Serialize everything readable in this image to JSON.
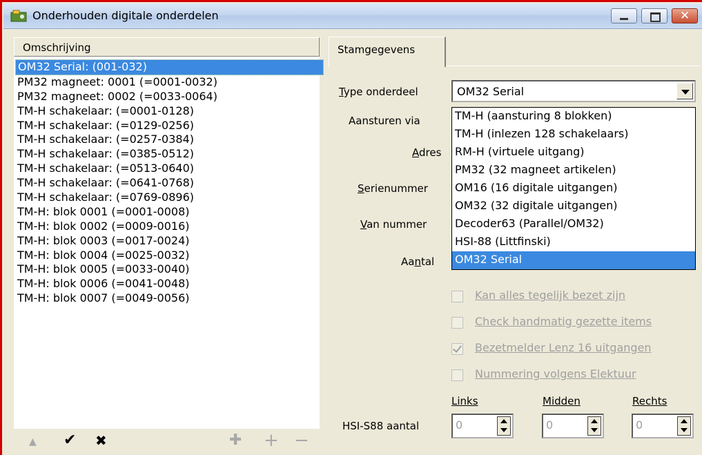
{
  "window": {
    "title": "Onderhouden digitale onderdelen",
    "icon": "app-icon",
    "controls": [
      "minimize-icon",
      "maximize-icon",
      "close-icon"
    ]
  },
  "left": {
    "column_header": "Omschrijving",
    "items": [
      "OM32 Serial: (001-032)",
      "PM32 magneet: 0001 (=0001-0032)",
      "PM32 magneet: 0002 (=0033-0064)",
      "TM-H schakelaar:  (=0001-0128)",
      "TM-H schakelaar:  (=0129-0256)",
      "TM-H schakelaar:  (=0257-0384)",
      "TM-H schakelaar:  (=0385-0512)",
      "TM-H schakelaar:  (=0513-0640)",
      "TM-H schakelaar:  (=0641-0768)",
      "TM-H schakelaar:  (=0769-0896)",
      "TM-H: blok 0001 (=0001-0008)",
      "TM-H: blok 0002 (=0009-0016)",
      "TM-H: blok 0003 (=0017-0024)",
      "TM-H: blok 0004 (=0025-0032)",
      "TM-H: blok 0005 (=0033-0040)",
      "TM-H: blok 0006 (=0041-0048)",
      "TM-H: blok 0007 (=0049-0056)"
    ],
    "toolbar": {
      "up": "▲",
      "ok": "✔",
      "cancel": "✖",
      "add_multi": "✚",
      "add": "+",
      "remove": "−"
    }
  },
  "tab": {
    "label": "Stamgegevens"
  },
  "form": {
    "type_label_u": "T",
    "type_label_rest": "ype onderdeel",
    "aansturen_label": "Aansturen via",
    "adres_label_u": "A",
    "adres_label_rest": "dres",
    "serie_label_u": "S",
    "serie_label_rest": "erienummer",
    "van_label_u": "V",
    "van_label_rest": "an nummer",
    "aantal_label_pre": "Aa",
    "aantal_label_u": "n",
    "aantal_label_rest": "tal",
    "type_value": "OM32 Serial",
    "options": [
      "TM-H (aansturing 8 blokken)",
      "TM-H (inlezen 128 schakelaars)",
      "RM-H (virtuele uitgang)",
      "PM32 (32 magneet artikelen)",
      "OM16 (16 digitale uitgangen)",
      "OM32 (32 digitale uitgangen)",
      "Decoder63 (Parallel/OM32)",
      "HSI-88 (Littfinski)",
      "OM32 Serial"
    ],
    "checkboxes": [
      {
        "label": "Kan alles tegelijk bezet zijn",
        "checked": false
      },
      {
        "label": "Check handmatig gezette items",
        "checked": false
      },
      {
        "label": "Bezetmelder Lenz 16 uitgangen",
        "checked": true
      },
      {
        "label": "Nummering volgens Elektuur",
        "checked": false
      }
    ],
    "hsi_label": "HSI-S88 aantal",
    "links_label": "Links",
    "midden_label": "Midden",
    "rechts_label": "Rechts",
    "links_value": "0",
    "midden_value": "0",
    "rechts_value": "0"
  }
}
